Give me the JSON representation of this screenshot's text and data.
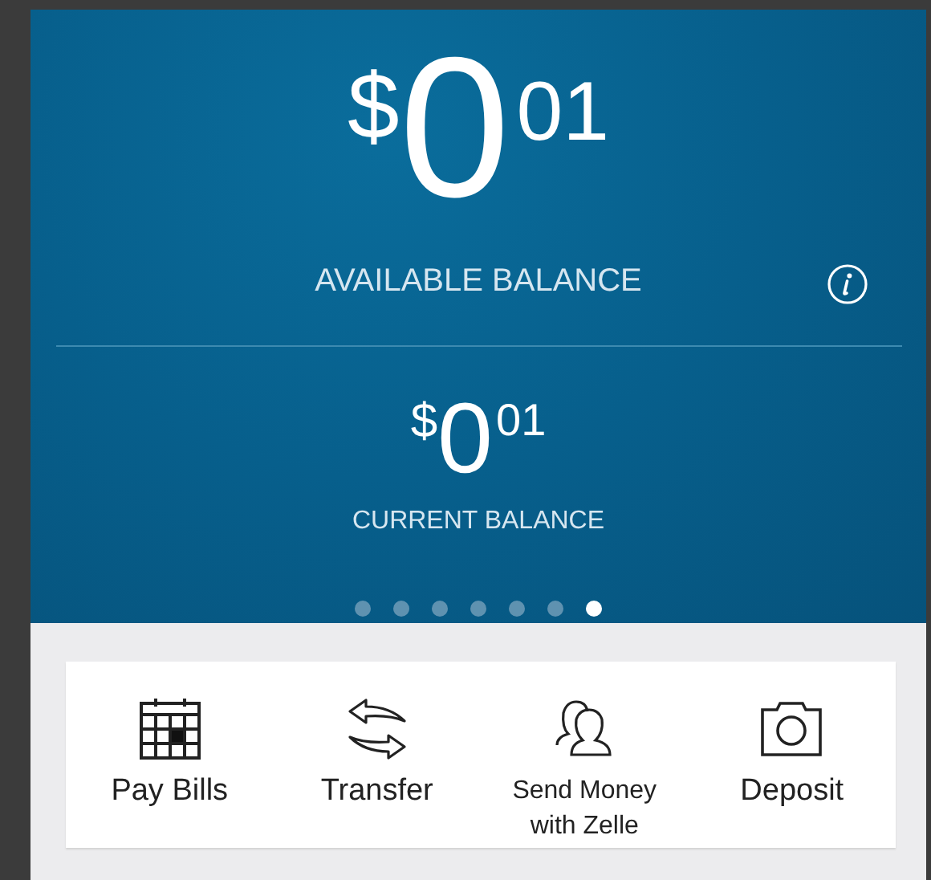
{
  "balances": [
    {
      "currency": "$",
      "whole": "0",
      "cents": "01",
      "label": "AVAILABLE BALANCE",
      "kind": "primary",
      "info": true
    },
    {
      "currency": "$",
      "whole": "0",
      "cents": "01",
      "label": "CURRENT BALANCE",
      "kind": "secondary",
      "info": false
    }
  ],
  "pager": [
    {
      "selected": false
    },
    {
      "selected": false
    },
    {
      "selected": false
    },
    {
      "selected": false
    },
    {
      "selected": false
    },
    {
      "selected": false
    },
    {
      "selected": true
    }
  ],
  "actions": [
    {
      "kind": "calendar",
      "label": "Pay Bills"
    },
    {
      "kind": "transfer",
      "label": "Transfer"
    },
    {
      "kind": "people",
      "label": "Send Money with Zelle"
    },
    {
      "kind": "camera",
      "label": "Deposit"
    }
  ]
}
